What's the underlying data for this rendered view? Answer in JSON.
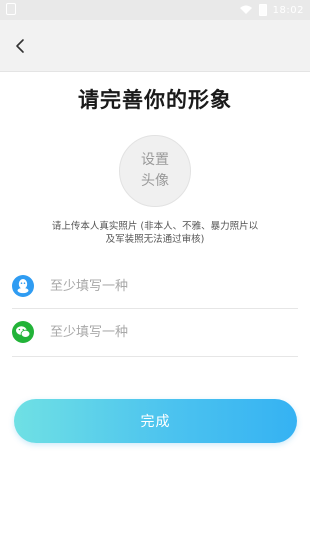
{
  "status_bar": {
    "time": "18:02"
  },
  "header": {
    "back_icon": "chevron-left-icon"
  },
  "page": {
    "title": "请完善你的形象",
    "avatar_line1": "设置",
    "avatar_line2": "头像",
    "hint_line1": "请上传本人真实照片 (非本人、不雅、暴力照片以",
    "hint_line2": "及军装照无法通过审核)"
  },
  "form": {
    "qq": {
      "icon": "qq-icon",
      "placeholder": "至少填写一种",
      "value": ""
    },
    "wechat": {
      "icon": "wechat-icon",
      "placeholder": "至少填写一种",
      "value": ""
    },
    "submit_label": "完成"
  },
  "colors": {
    "qq": "#2f9cf2",
    "wechat": "#22b338",
    "button_gradient_start": "#6fe0e4",
    "button_gradient_end": "#35b2f3"
  }
}
